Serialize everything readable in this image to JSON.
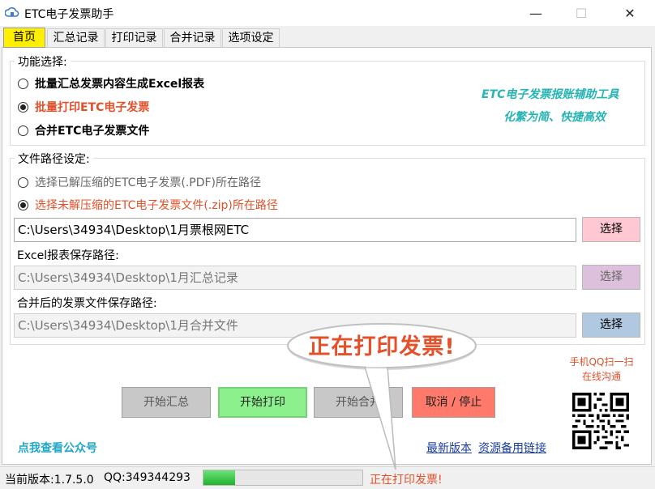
{
  "window": {
    "title": "ETC电子发票助手",
    "controls": {
      "minimize": "—",
      "maximize": "☐",
      "close": "✕"
    }
  },
  "tabs": [
    {
      "label": "首页",
      "active": true
    },
    {
      "label": "汇总记录"
    },
    {
      "label": "打印记录"
    },
    {
      "label": "合并记录"
    },
    {
      "label": "选项设定"
    }
  ],
  "function_group": {
    "legend": "功能选择:",
    "options": [
      {
        "label": "批量汇总发票内容生成Excel报表",
        "checked": false
      },
      {
        "label": "批量打印ETC电子发票",
        "checked": true
      },
      {
        "label": "合并ETC电子发票文件",
        "checked": false
      }
    ],
    "slogan_line1": "ETC电子发票报账辅助工具",
    "slogan_line2": "化繁为简、快捷高效"
  },
  "path_group": {
    "legend": "文件路径设定:",
    "options": [
      {
        "label": "选择已解压缩的ETC电子发票(.PDF)所在路径",
        "checked": false
      },
      {
        "label": "选择未解压缩的ETC电子发票文件(.zip)所在路径",
        "checked": true
      }
    ],
    "source_path": "C:\\Users\\34934\\Desktop\\1月票根网ETC",
    "excel_label": "Excel报表保存路径:",
    "excel_path": "C:\\Users\\34934\\Desktop\\1月汇总记录",
    "merge_label": "合并后的发票文件保存路径:",
    "merge_path": "C:\\Users\\34934\\Desktop\\1月合并文件",
    "select_label": "选择"
  },
  "colors": {
    "select_btn_1": "#ffc8d2",
    "select_btn_2": "#dcc0dc",
    "select_btn_3": "#b0c8e0",
    "accent_red": "#e2502a",
    "slogan_teal": "#28b4b4"
  },
  "actions": {
    "start_summary": "开始汇总",
    "start_print": "开始打印",
    "start_merge": "开始合并",
    "cancel_stop": "取消 / 停止"
  },
  "qr": {
    "caption_line1": "手机QQ扫一扫",
    "caption_line2": "在线沟通",
    "icon": "qr-code-icon"
  },
  "links": {
    "public_account": "点我查看公众号",
    "latest_version": "最新版本",
    "backup_link": "资源备用链接"
  },
  "callout": {
    "text": "正在打印发票!"
  },
  "status": {
    "version": "当前版本:1.7.5.0",
    "qq": "QQ:349344293",
    "progress_fraction": 0.2,
    "message": "正在打印发票!"
  }
}
